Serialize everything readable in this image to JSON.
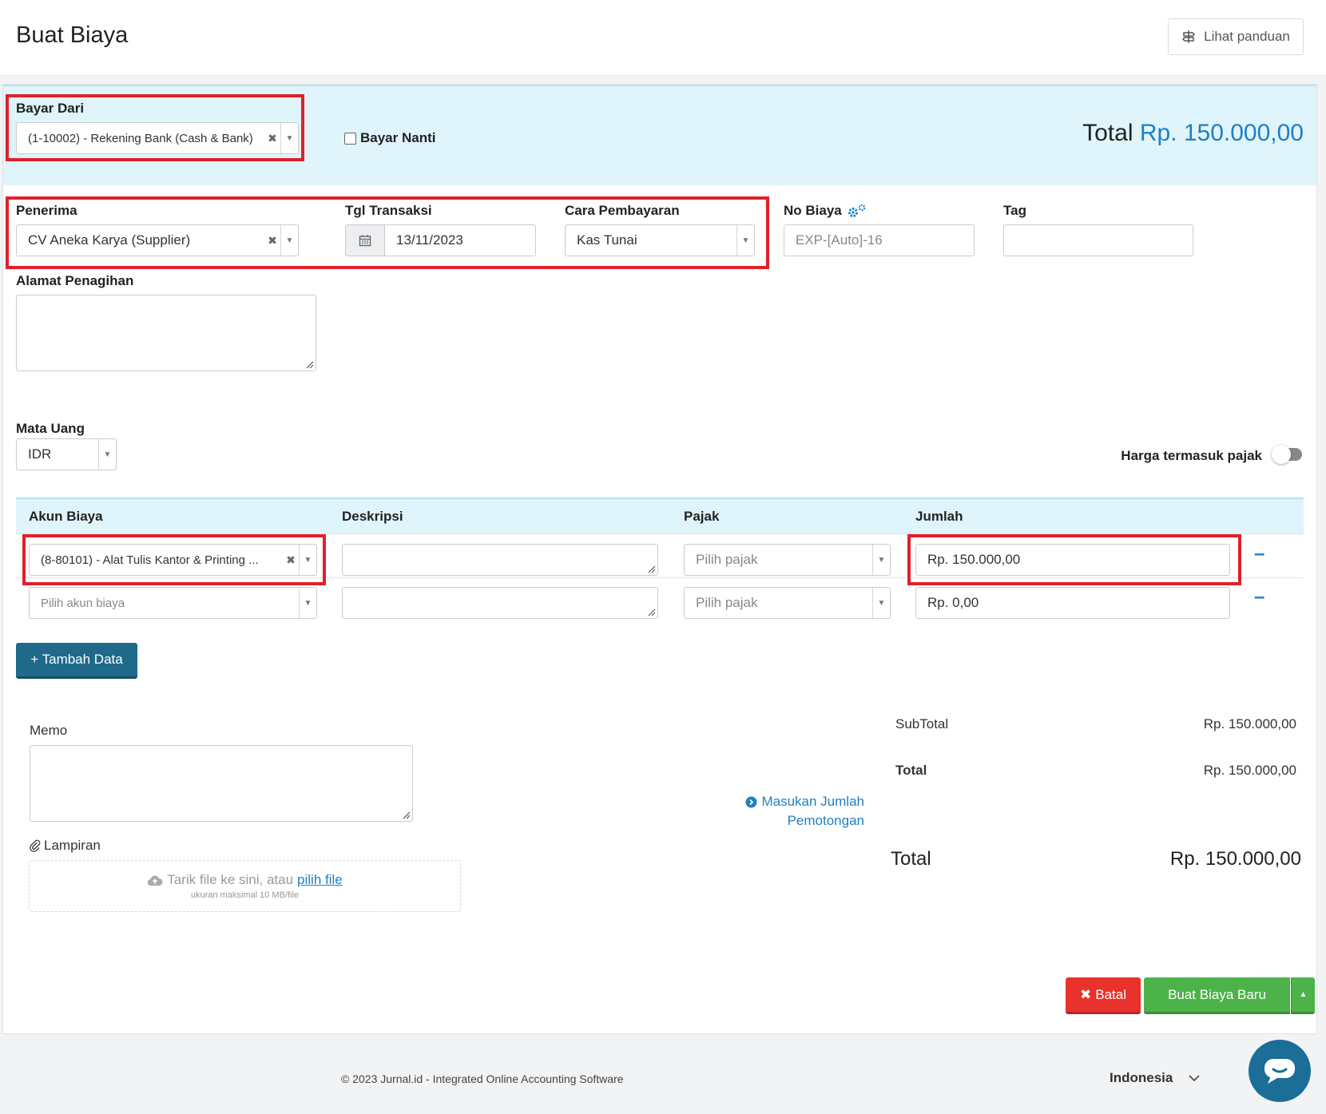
{
  "header": {
    "title": "Buat Biaya",
    "guide_label": "Lihat panduan"
  },
  "pay_from": {
    "label": "Bayar Dari",
    "value": "(1-10002) - Rekening Bank (Cash & Bank)"
  },
  "pay_later": {
    "label": "Bayar Nanti"
  },
  "total_top": {
    "label": "Total",
    "value": "Rp. 150.000,00"
  },
  "recipient": {
    "label": "Penerima",
    "value": "CV Aneka Karya (Supplier)"
  },
  "transaction_date": {
    "label": "Tgl Transaksi",
    "value": "13/11/2023"
  },
  "payment_method": {
    "label": "Cara Pembayaran",
    "value": "Kas Tunai"
  },
  "expense_no": {
    "label": "No Biaya",
    "placeholder": "EXP-[Auto]-16"
  },
  "tag": {
    "label": "Tag",
    "value": ""
  },
  "billing_address": {
    "label": "Alamat Penagihan"
  },
  "currency": {
    "label": "Mata Uang",
    "value": "IDR"
  },
  "tax_inclusive": {
    "label": "Harga termasuk pajak",
    "on": false
  },
  "table": {
    "columns": [
      "Akun Biaya",
      "Deskripsi",
      "Pajak",
      "Jumlah"
    ],
    "rows": [
      {
        "account": "(8-80101) - Alat Tulis Kantor & Printing ...",
        "description": "",
        "tax_placeholder": "Pilih pajak",
        "amount": "Rp. 150.000,00"
      },
      {
        "account_placeholder": "Pilih akun biaya",
        "description": "",
        "tax_placeholder": "Pilih pajak",
        "amount": "Rp. 0,00"
      }
    ]
  },
  "add_row_label": "+ Tambah Data",
  "memo": {
    "label": "Memo"
  },
  "attachment": {
    "label": "Lampiran",
    "drop_text": "Tarik file ke sini, atau",
    "pick_link": "pilih file",
    "size_note": "ukuran maksimal 10 MB/file"
  },
  "summary": {
    "subtotal_label": "SubTotal",
    "subtotal_value": "Rp. 150.000,00",
    "total_label": "Total",
    "total_value": "Rp. 150.000,00",
    "deduction_link_line1": "Masukan Jumlah",
    "deduction_link_line2": "Pemotongan",
    "grand_total_label": "Total",
    "grand_total_value": "Rp. 150.000,00"
  },
  "actions": {
    "cancel_label": "Batal",
    "create_label": "Buat Biaya Baru"
  },
  "footer": {
    "copyright": "© 2023 Jurnal.id - Integrated Online Accounting Software",
    "language": "Indonesia"
  },
  "colors": {
    "accent": "#1f7fc4",
    "highlight_border": "#e0202a",
    "cancel": "#e8322b",
    "create": "#4cb24a",
    "band": "#dff4fb"
  }
}
